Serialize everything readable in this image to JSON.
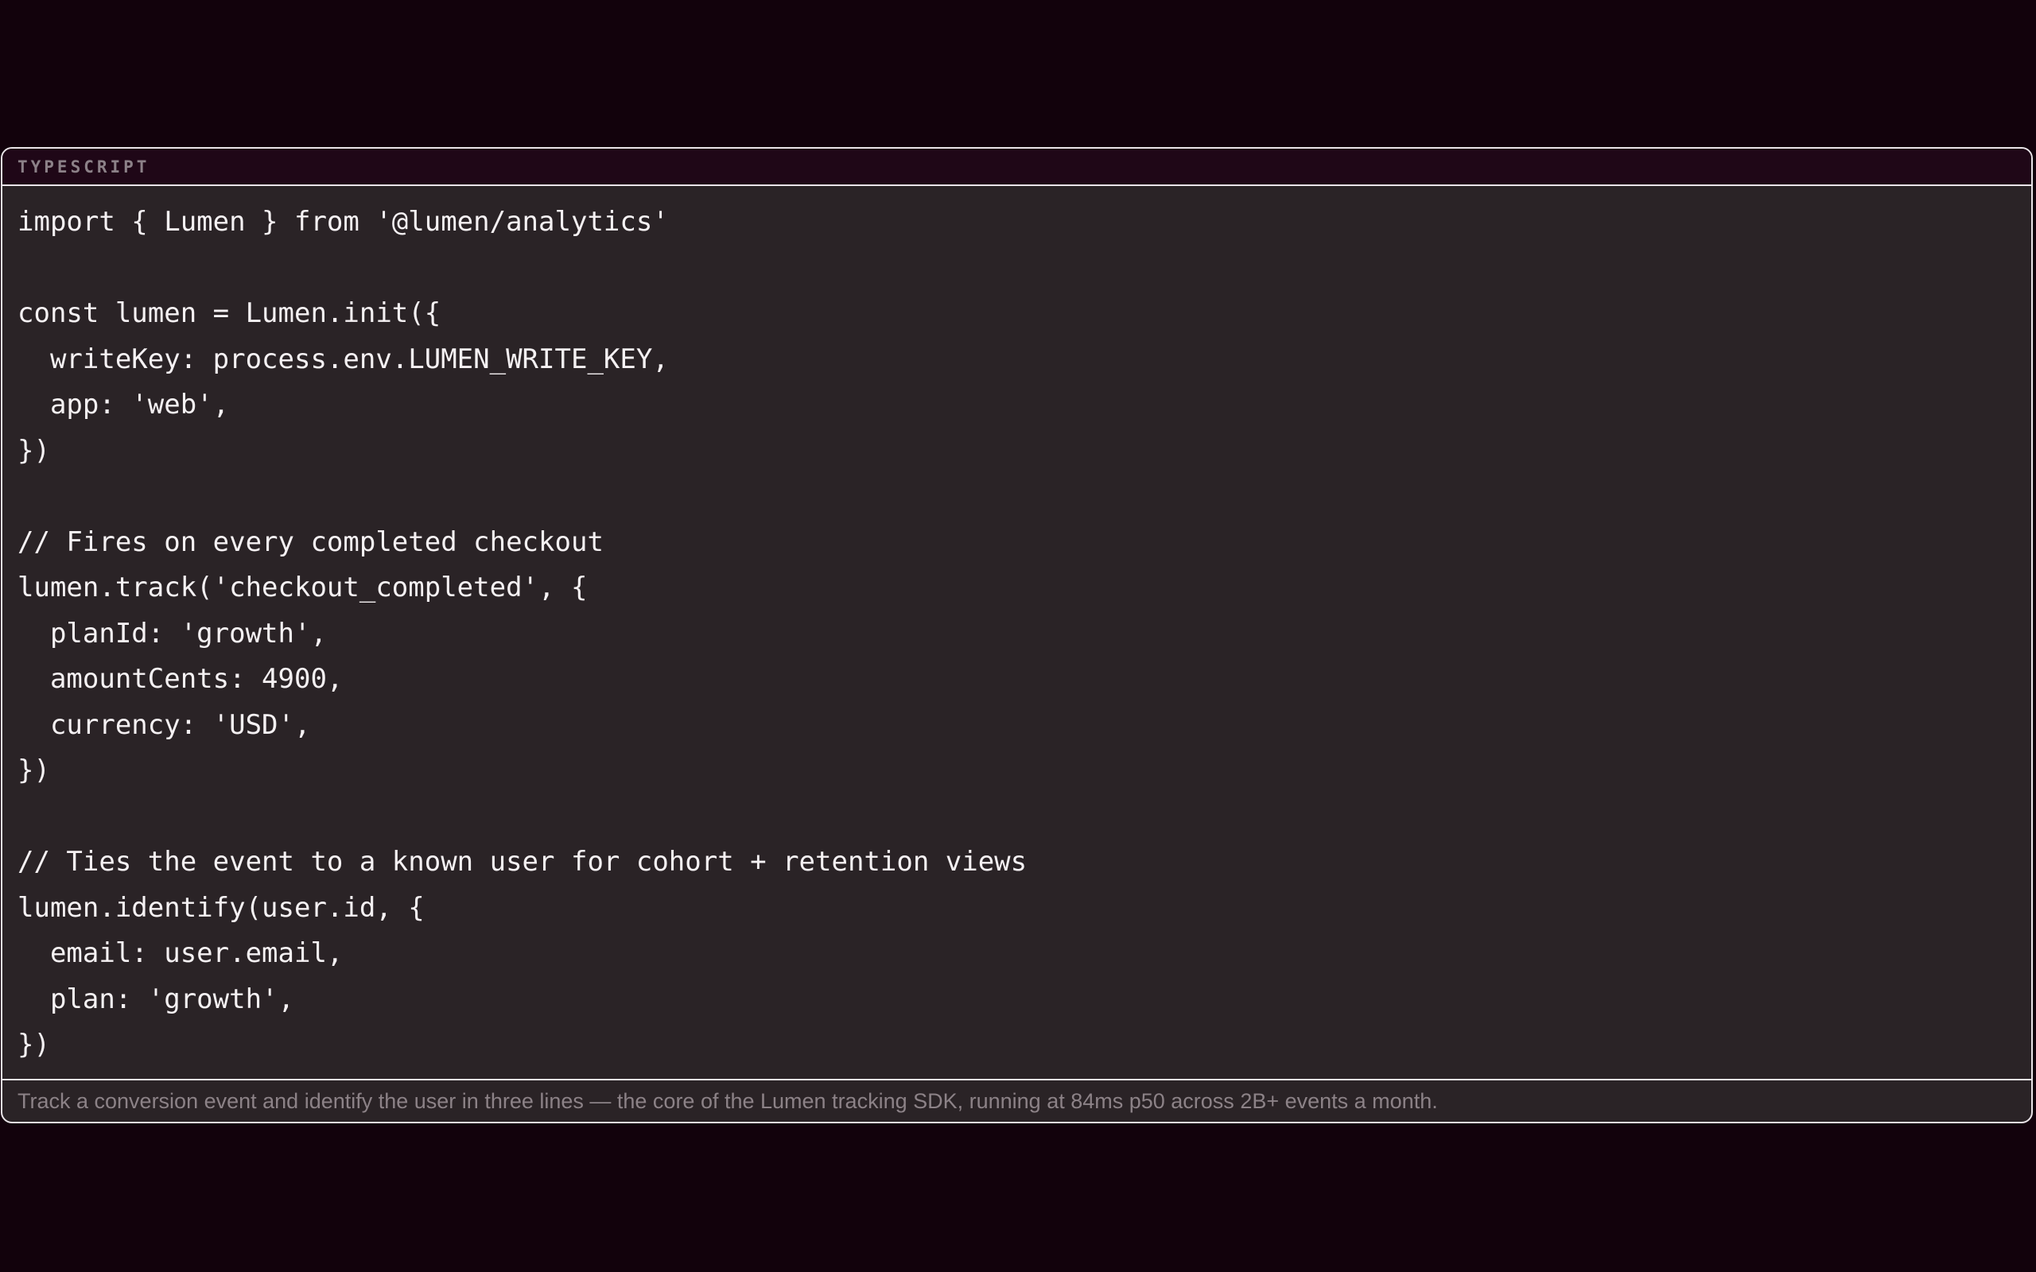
{
  "code_block": {
    "language": "TYPESCRIPT",
    "lines": [
      "import { Lumen } from '@lumen/analytics'",
      "",
      "const lumen = Lumen.init({",
      "  writeKey: process.env.LUMEN_WRITE_KEY,",
      "  app: 'web',",
      "})",
      "",
      "// Fires on every completed checkout",
      "lumen.track('checkout_completed', {",
      "  planId: 'growth',",
      "  amountCents: 4900,",
      "  currency: 'USD',",
      "})",
      "",
      "// Ties the event to a known user for cohort + retention views",
      "lumen.identify(user.id, {",
      "  email: user.email,",
      "  plan: 'growth',",
      "})"
    ],
    "caption": "Track a conversion event and identify the user in three lines — the core of the Lumen tracking SDK, running at 84ms p50 across 2B+ events a month."
  },
  "colors": {
    "page_background": "#12020c",
    "panel_background": "#2a2326",
    "header_background": "#1f0717",
    "code_text": "#f5f1f3",
    "muted_text": "#8c8188",
    "border": "#e9e4e8"
  }
}
